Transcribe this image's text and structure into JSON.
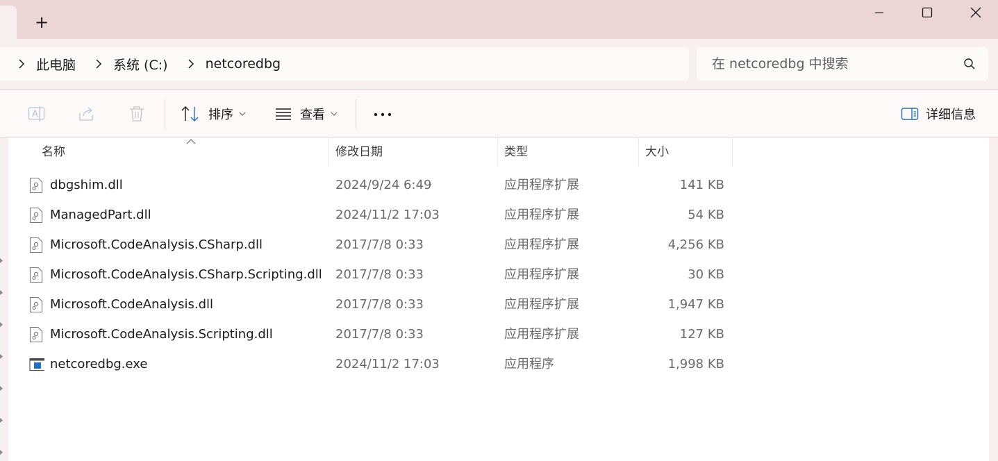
{
  "window": {
    "new_tab_glyph": "+",
    "icons": {
      "minimize": "minimize-icon",
      "maximize": "maximize-icon",
      "close": "close-icon"
    }
  },
  "breadcrumb": {
    "items": [
      "此电脑",
      "系统 (C:)",
      "netcoredbg"
    ],
    "separator_icon": "chevron-right-icon"
  },
  "search": {
    "placeholder": "在 netcoredbg 中搜索",
    "icon": "search-icon"
  },
  "toolbar": {
    "disabled_icons": [
      "rename-icon",
      "share-icon",
      "delete-icon"
    ],
    "sort_label": "排序",
    "view_label": "查看",
    "more_icon": "more-dots-icon",
    "details_label": "详细信息"
  },
  "columns": {
    "name": "名称",
    "date": "修改日期",
    "type": "类型",
    "size": "大小"
  },
  "files": [
    {
      "name": "dbgshim.dll",
      "date": "2024/9/24 6:49",
      "type": "应用程序扩展",
      "size": "141 KB",
      "icon": "dll-file-icon"
    },
    {
      "name": "ManagedPart.dll",
      "date": "2024/11/2 17:03",
      "type": "应用程序扩展",
      "size": "54 KB",
      "icon": "dll-file-icon"
    },
    {
      "name": "Microsoft.CodeAnalysis.CSharp.dll",
      "date": "2017/7/8 0:33",
      "type": "应用程序扩展",
      "size": "4,256 KB",
      "icon": "dll-file-icon"
    },
    {
      "name": "Microsoft.CodeAnalysis.CSharp.Scripting.dll",
      "date": "2017/7/8 0:33",
      "type": "应用程序扩展",
      "size": "30 KB",
      "icon": "dll-file-icon"
    },
    {
      "name": "Microsoft.CodeAnalysis.dll",
      "date": "2017/7/8 0:33",
      "type": "应用程序扩展",
      "size": "1,947 KB",
      "icon": "dll-file-icon"
    },
    {
      "name": "Microsoft.CodeAnalysis.Scripting.dll",
      "date": "2017/7/8 0:33",
      "type": "应用程序扩展",
      "size": "127 KB",
      "icon": "dll-file-icon"
    },
    {
      "name": "netcoredbg.exe",
      "date": "2024/11/2 17:03",
      "type": "应用程序",
      "size": "1,998 KB",
      "icon": "exe-file-icon"
    }
  ],
  "colors": {
    "titlebar": "#ecd6d5",
    "address_bg": "#f8f0f0",
    "accent_blue": "#1e6fc8",
    "secondary_text": "#6a6a6a"
  }
}
